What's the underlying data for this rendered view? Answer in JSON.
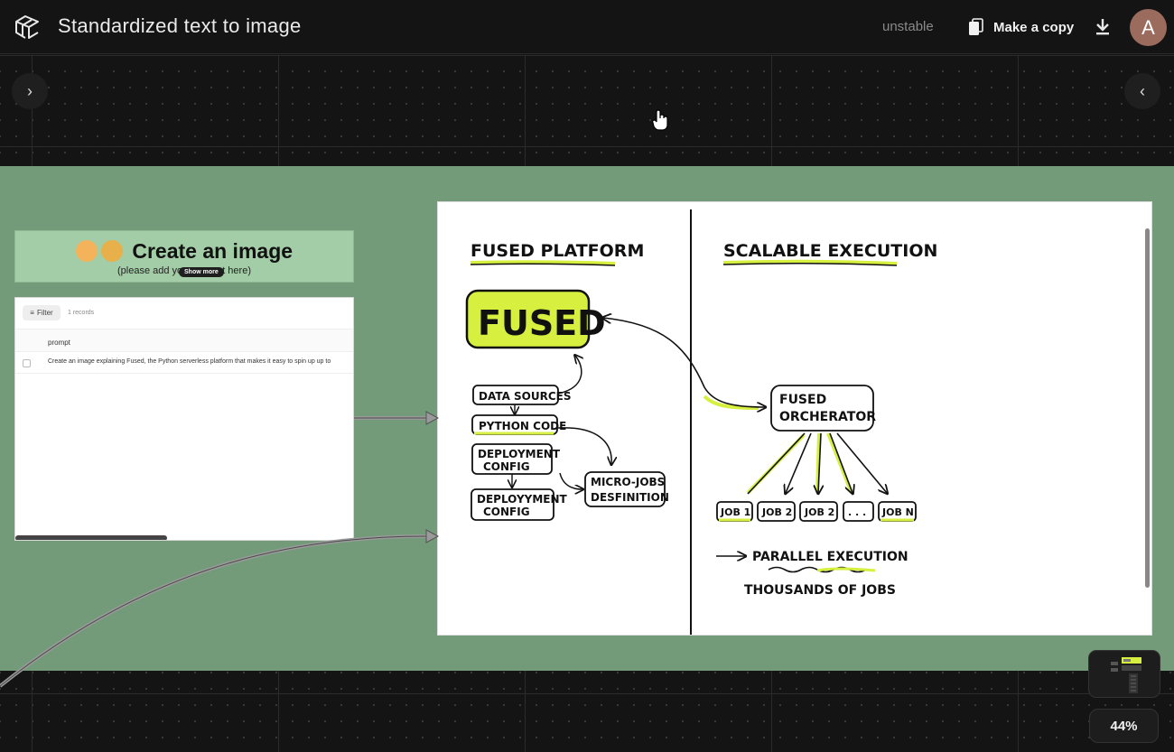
{
  "app": {
    "title": "Standardized text to image",
    "status": "unstable",
    "copy_label": "Make a copy",
    "avatar_initial": "A"
  },
  "canvas": {
    "zoom": "44%",
    "header_node": {
      "title": "Create an image",
      "subtitle": "(please add your prompt here)",
      "show_more": "Show more"
    },
    "table_node": {
      "filter_label": "Filter",
      "records": "1 records",
      "column": "prompt",
      "rows": [
        "Create an image explaining Fused, the Python serverless platform that makes it easy to spin up up to"
      ]
    }
  },
  "image": {
    "left_title": "FUSED PLATFORM",
    "right_title": "SCALABLE EXECUTION",
    "fused": "FUSED",
    "data_sources": "DATA SOURCES",
    "python_code": "PYTHON CODE",
    "deployment_config": [
      "DEPLOYMENT",
      "CONFIG"
    ],
    "deployyment_config": [
      "DEPLOYYMENT",
      "CONFIG"
    ],
    "micro_jobs": [
      "MICRO-JOBS",
      "DESFINITION"
    ],
    "orchestrator": [
      "FUSED",
      "ORCHERATOR"
    ],
    "jobs": [
      "JOB 1",
      "JOB 2",
      "JOB 2",
      ". . .",
      "JOB N"
    ],
    "parallel": "PARALLEL EXECUTION",
    "thousands": "THOUSANDS OF JOBS",
    "accent": "#d7ef3f"
  },
  "colors": {
    "group": "#739a79",
    "header_node": "#a3cda6",
    "topbar": "#141414"
  }
}
